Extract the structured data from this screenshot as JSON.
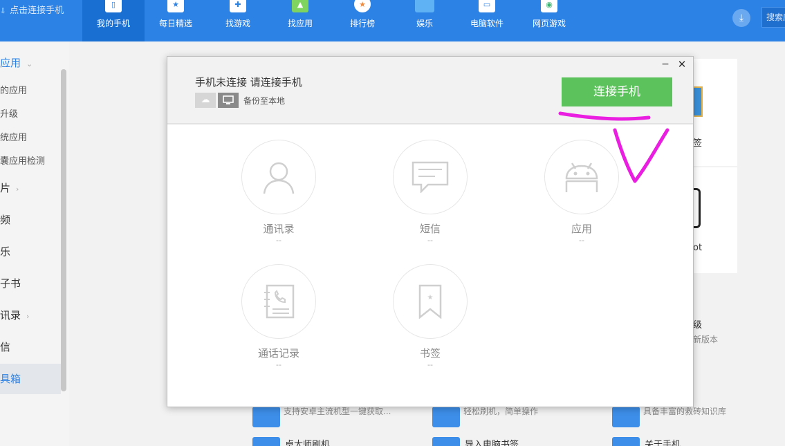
{
  "topbar": {
    "connect_link": "点击连接手机",
    "nav": [
      {
        "label": "我的手机",
        "icon": "phone-icon",
        "active": true
      },
      {
        "label": "每日精选",
        "icon": "star-icon",
        "active": false
      },
      {
        "label": "找游戏",
        "icon": "gamepad-icon",
        "active": false
      },
      {
        "label": "找应用",
        "icon": "android-bag-icon",
        "active": false
      },
      {
        "label": "排行榜",
        "icon": "ranking-icon",
        "active": false
      },
      {
        "label": "娱乐",
        "icon": "entertainment-icon",
        "active": false
      },
      {
        "label": "电脑软件",
        "icon": "monitor-icon",
        "active": false
      },
      {
        "label": "网页游戏",
        "icon": "web-game-icon",
        "active": false
      }
    ],
    "search_placeholder": "搜索应"
  },
  "sidebar": {
    "section_apps": "应用",
    "sub_items": [
      "的应用",
      "升级",
      "统应用",
      "囊应用检测"
    ],
    "main_items": [
      "图片",
      "视频",
      "音乐",
      "电子书",
      "通讯录",
      "短信",
      "工具箱"
    ],
    "main_display": [
      "片",
      "频",
      "乐",
      "子书",
      "讯录",
      "信",
      "具箱"
    ]
  },
  "background": {
    "right_text_1": "签",
    "right_text_2": "ot",
    "upgrade_title": "级",
    "upgrade_sub": "新版本",
    "row1": [
      {
        "text": "支持安卓主流机型一键获取..."
      },
      {
        "text": "轻松刷机，简单操作"
      },
      {
        "text": "具备丰富的救砖知识库"
      }
    ],
    "row2": [
      {
        "text": "卓大师刷机"
      },
      {
        "text": "导入电脑书签"
      },
      {
        "text": "关于手机"
      }
    ]
  },
  "dialog": {
    "title": "手机未连接 请连接手机",
    "backup_label": "备份至本地",
    "connect_button": "连接手机",
    "minimize": "−",
    "close": "✕",
    "features": [
      {
        "label": "通讯录",
        "count": "--",
        "icon": "contacts-icon"
      },
      {
        "label": "短信",
        "count": "--",
        "icon": "sms-icon"
      },
      {
        "label": "应用",
        "count": "--",
        "icon": "android-icon"
      },
      {
        "label": "通话记录",
        "count": "--",
        "icon": "call-log-icon"
      },
      {
        "label": "书签",
        "count": "--",
        "icon": "bookmark-icon"
      }
    ]
  },
  "colors": {
    "topbar": "#2d82e6",
    "active_tab": "#1a6fd2",
    "connect_button": "#5cc35c",
    "annotation": "#e91ee0"
  }
}
